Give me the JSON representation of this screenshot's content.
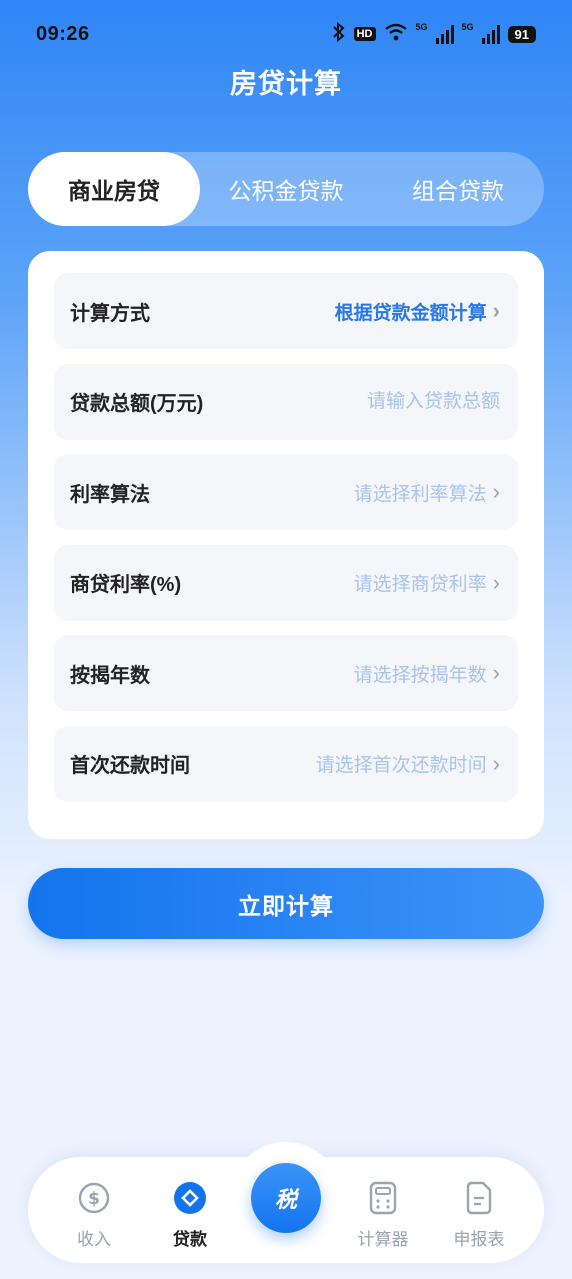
{
  "status_bar": {
    "time": "09:26",
    "network_1": "5G",
    "network_2": "5G",
    "battery": "91",
    "hd": "HD"
  },
  "header": {
    "title": "房贷计算"
  },
  "tabs": [
    {
      "label": "商业房贷",
      "active": true
    },
    {
      "label": "公积金贷款",
      "active": false
    },
    {
      "label": "组合贷款",
      "active": false
    }
  ],
  "form": {
    "calc_method": {
      "label": "计算方式",
      "value": "根据贷款金额计算"
    },
    "loan_total": {
      "label": "贷款总额(万元)",
      "placeholder": "请输入贷款总额"
    },
    "rate_algorithm": {
      "label": "利率算法",
      "placeholder": "请选择利率算法"
    },
    "commercial_rate": {
      "label": "商贷利率(%)",
      "placeholder": "请选择商贷利率"
    },
    "mortgage_years": {
      "label": "按揭年数",
      "placeholder": "请选择按揭年数"
    },
    "first_payment_time": {
      "label": "首次还款时间",
      "placeholder": "请选择首次还款时间"
    }
  },
  "calculate_button": "立即计算",
  "tabbar": {
    "income": "收入",
    "loan": "贷款",
    "center": "税",
    "calculator": "计算器",
    "report": "申报表"
  },
  "colors": {
    "accent": "#1474ee",
    "placeholder": "#a8c3ec",
    "active_value": "#2a78e8"
  }
}
